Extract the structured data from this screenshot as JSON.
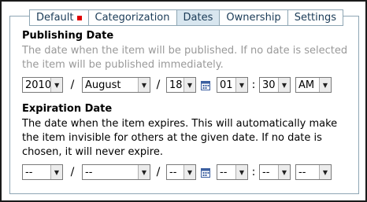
{
  "tabs": [
    {
      "label": "Default",
      "active": false,
      "required": true
    },
    {
      "label": "Categorization",
      "active": false
    },
    {
      "label": "Dates",
      "active": true
    },
    {
      "label": "Ownership",
      "active": false
    },
    {
      "label": "Settings",
      "active": false
    }
  ],
  "publishing": {
    "title": "Publishing Date",
    "description": "The date when the item will be published. If no date is selected the item will be published immediately.",
    "year": "2010",
    "month": "August",
    "day": "18",
    "hour": "01",
    "minute": "30",
    "ampm": "AM"
  },
  "expiration": {
    "title": "Expiration Date",
    "description": "The date when the item expires. This will automatically make the item invisible for others at the given date. If no date is chosen, it will never expire.",
    "year": "--",
    "month": "--",
    "day": "--",
    "hour": "--",
    "minute": "--",
    "ampm": "--"
  },
  "separators": {
    "date": "/",
    "time": ":"
  },
  "colors": {
    "required_marker": "#e00000",
    "active_tab": "#d8e6ef",
    "border": "#8ea6b4"
  },
  "icons": {
    "calendar": "calendar-icon",
    "dropdown": "chevron-down-icon"
  }
}
